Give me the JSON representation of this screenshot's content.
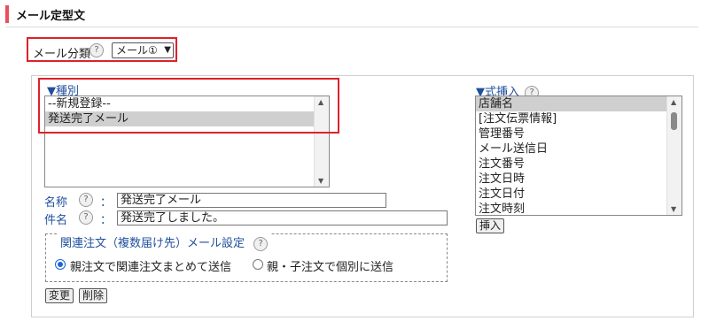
{
  "header": {
    "title": "メール定型文"
  },
  "category": {
    "label": "メール分類",
    "help": "?",
    "selected": "メール①"
  },
  "type_section": {
    "heading": "▼種別",
    "items": [
      "--新規登録--",
      "発送完了メール"
    ],
    "selected_index": 1
  },
  "fields": {
    "name_label": "名称",
    "name_value": "発送完了メール",
    "subject_label": "件名",
    "subject_value": "発送完了しました。",
    "colon": "：",
    "help": "?"
  },
  "related_order": {
    "legend": "関連注文（複数届け先）メール設定",
    "help": "?",
    "options": [
      "親注文で関連注文まとめて送信",
      "親・子注文で個別に送信"
    ],
    "selected_index": 0
  },
  "buttons": {
    "change": "変更",
    "delete": "削除",
    "insert": "挿入"
  },
  "formula_section": {
    "heading": "▼式挿入",
    "help": "?",
    "items": [
      "店舗名",
      "[注文伝票情報]",
      "管理番号",
      "メール送信日",
      "注文番号",
      "注文日時",
      "注文日付",
      "注文時刻"
    ],
    "selected_index": 0
  }
}
